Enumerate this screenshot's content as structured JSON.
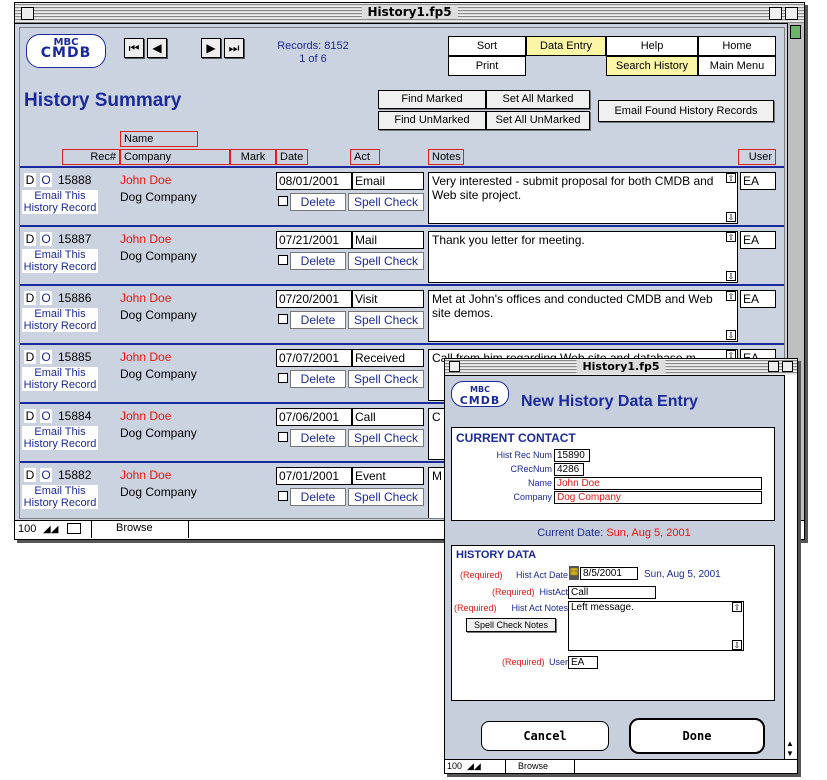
{
  "main": {
    "title": "History1.fp5",
    "logo": {
      "line1": "MBC",
      "line2": "CMDB"
    },
    "records_label": "Records: 8152",
    "records_pos": "1 of 6",
    "nav": {
      "first": "⏮",
      "prev": "◀",
      "next": "▶",
      "last": "⏭"
    },
    "menu": {
      "sort": "Sort",
      "data_entry": "Data Entry",
      "help": "Help",
      "home": "Home",
      "print": "Print",
      "search_history": "Search History",
      "main_menu": "Main Menu"
    },
    "heading": "History Summary",
    "buttons": {
      "find_marked": "Find Marked",
      "set_all_marked": "Set All Marked",
      "find_unmarked": "Find UnMarked",
      "set_all_unmarked": "Set All UnMarked",
      "email_found": "Email Found History Records"
    },
    "columns": {
      "rec": "Rec#",
      "name": "Name",
      "company": "Company",
      "mark": "Mark",
      "date": "Date",
      "act": "Act",
      "notes": "Notes",
      "user": "User"
    },
    "row_labels": {
      "d": "D",
      "o": "O",
      "email_line1": "Email This",
      "email_line2": "History Record",
      "delete": "Delete",
      "spell_check": "Spell Check"
    },
    "rows": [
      {
        "rec": "15888",
        "name": "John Doe",
        "company": "Dog Company",
        "date": "08/01/2001",
        "act": "Email",
        "notes": "Very interested - submit proposal for both CMDB and Web site project.",
        "user": "EA"
      },
      {
        "rec": "15887",
        "name": "John Doe",
        "company": "Dog Company",
        "date": "07/21/2001",
        "act": "Mail",
        "notes": "Thank you letter for meeting.",
        "user": "EA"
      },
      {
        "rec": "15886",
        "name": "John Doe",
        "company": "Dog Company",
        "date": "07/20/2001",
        "act": "Visit",
        "notes": "Met at John's offices and conducted CMDB and Web site demos.",
        "user": "EA"
      },
      {
        "rec": "15885",
        "name": "John Doe",
        "company": "Dog Company",
        "date": "07/07/2001",
        "act": "Received",
        "notes": "Call from him regarding Web site and database m",
        "user": "EA"
      },
      {
        "rec": "15884",
        "name": "John Doe",
        "company": "Dog Company",
        "date": "07/06/2001",
        "act": "Call",
        "notes": "C",
        "user": ""
      },
      {
        "rec": "15882",
        "name": "John Doe",
        "company": "Dog Company",
        "date": "07/01/2001",
        "act": "Event",
        "notes": "M c",
        "user": ""
      }
    ],
    "status": {
      "zoom": "100",
      "mode": "Browse"
    }
  },
  "dialog": {
    "title": "History1.fp5",
    "logo": {
      "line1": "MBC",
      "line2": "CMDB"
    },
    "heading": "New History Data Entry",
    "current_contact": "CURRENT CONTACT",
    "labels": {
      "hist_rec_num": "Hist Rec Num",
      "crecnum": "CRecNum",
      "name": "Name",
      "company": "Company"
    },
    "values": {
      "hist_rec_num": "15890",
      "crecnum": "4286",
      "name": "John Doe",
      "company": "Dog Company"
    },
    "current_date_label": "Current Date:",
    "current_date": "Sun, Aug 5, 2001",
    "history_data": "HISTORY DATA",
    "required": "(Required)",
    "hist_act_date_label": "Hist Act Date",
    "hist_act_date": "8/5/2001",
    "hist_act_date_long": "Sun, Aug 5, 2001",
    "hist_act_label": "HistAct",
    "hist_act": "Call",
    "hist_act_notes_label": "Hist Act Notes",
    "hist_act_notes": "Left message.",
    "spell_check_notes": "Spell Check Notes",
    "user_label": "User",
    "user": "EA",
    "cancel": "Cancel",
    "done": "Done",
    "status": {
      "zoom": "100",
      "mode": "Browse"
    }
  },
  "colors": {
    "accent_blue": "#1a2a9c",
    "required_red": "#e8140e",
    "highlight_yellow": "#fbf5a6"
  }
}
